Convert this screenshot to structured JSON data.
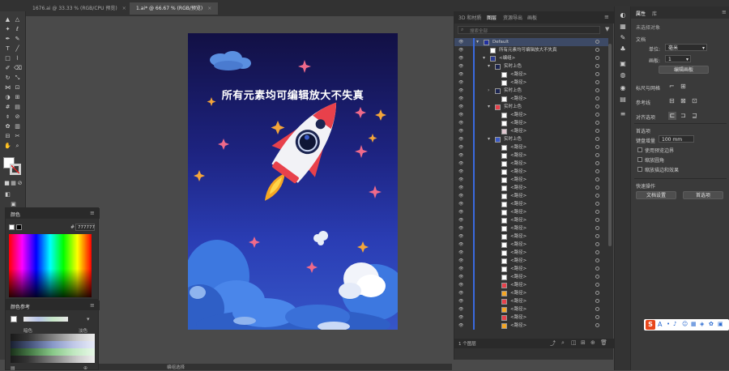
{
  "tabs": {
    "doc1": "1676.ai @ 33.33 % (RGB/CPU 预览)",
    "doc2": "1.ai* @ 66.67 % (RGB/预览)",
    "close": "×"
  },
  "artwork": {
    "headline": "所有元素均可编辑放大不失真"
  },
  "layers_panel": {
    "tabs": [
      "3D 和材质",
      "图层",
      "资源导出",
      "画板"
    ],
    "search_placeholder": "搜索全部",
    "layer_count": "1 个图层",
    "rows": [
      "Default",
      "所有元素均可编辑放大不失真",
      "<编组>",
      "实时上色",
      "<路径>",
      "<路径>",
      "实时上色",
      "<路径>",
      "实时上色",
      "<路径>",
      "<路径>",
      "<路径>",
      "实时上色",
      "<路径>",
      "<路径>",
      "<路径>",
      "<路径>",
      "<路径>",
      "<路径>",
      "<路径>",
      "<路径>",
      "<路径>",
      "<路径>",
      "<路径>",
      "<路径>",
      "<路径>",
      "<路径>",
      "<路径>",
      "<路径>",
      "<路径>",
      "<路径>",
      "<路径>",
      "<路径>",
      "<路径>",
      "<路径>",
      "<路径>"
    ]
  },
  "properties_panel": {
    "tabs": [
      "属性",
      "库"
    ],
    "no_selection": "未选择对象",
    "document": "文档",
    "units_label": "单位:",
    "units_value": "毫米",
    "artboard_label": "画板:",
    "artboard_value": "1",
    "edit_artboards": "编辑画板",
    "rulers_grids": "标尺与网格",
    "guides": "参考线",
    "align_to": "对齐选项",
    "preferences": "首选项",
    "keyboard_increment_label": "键盘增量",
    "keyboard_increment_value": "100 mm",
    "opt_preview_bounds": "使用预览边界",
    "opt_scale_corners": "缩放圆角",
    "opt_scale_strokes": "缩放描边和效果",
    "quick_actions": "快速操作",
    "document_setup": "文档设置",
    "preferences_button": "首选项"
  },
  "color_panel": {
    "title": "颜色",
    "hex_label": "#",
    "hex_value": "777777"
  },
  "color_guide": {
    "title": "颜色参考",
    "dark_label": "暗色",
    "light_label": "淡色"
  },
  "status_bar": {
    "tool_name": "编组选择"
  },
  "ime": {
    "brand": "S",
    "lang": "A"
  }
}
